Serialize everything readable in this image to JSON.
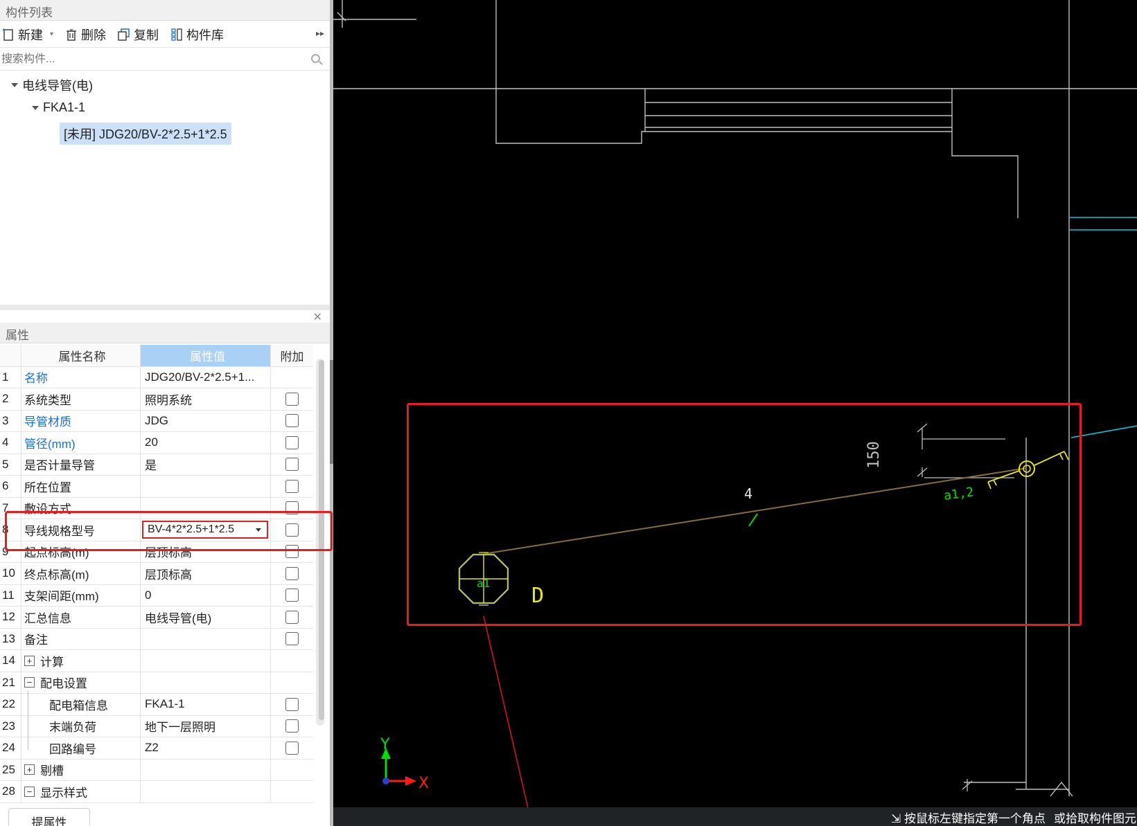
{
  "component_list": {
    "title": "构件列表",
    "toolbar": {
      "new": "新建",
      "delete": "删除",
      "copy": "复制",
      "library": "构件库"
    },
    "search_placeholder": "搜索构件...",
    "tree": {
      "root": "电线导管(电)",
      "child": "FKA1-1",
      "selected_item": "[未用] JDG20/BV-2*2.5+1*2.5"
    }
  },
  "properties": {
    "title": "属性",
    "columns": {
      "name": "属性名称",
      "value": "属性值",
      "extra": "附加"
    },
    "rows": [
      {
        "num": "1",
        "name": "名称",
        "value": "JDG20/BV-2*2.5+1...",
        "blue": true,
        "checkbox": false
      },
      {
        "num": "2",
        "name": "系统类型",
        "value": "照明系统",
        "blue": false,
        "checkbox": true
      },
      {
        "num": "3",
        "name": "导管材质",
        "value": "JDG",
        "blue": true,
        "checkbox": true
      },
      {
        "num": "4",
        "name": "管径(mm)",
        "value": "20",
        "blue": true,
        "checkbox": true
      },
      {
        "num": "5",
        "name": "是否计量导管",
        "value": "是",
        "blue": false,
        "checkbox": true
      },
      {
        "num": "6",
        "name": "所在位置",
        "value": "",
        "blue": false,
        "checkbox": true
      },
      {
        "num": "7",
        "name": "敷设方式",
        "value": "",
        "blue": false,
        "checkbox": true
      },
      {
        "num": "8",
        "name": "导线规格型号",
        "value": "BV-4*2*2.5+1*2.5",
        "blue": false,
        "checkbox": true,
        "dropdown": true
      },
      {
        "num": "9",
        "name": "起点标高(m)",
        "value": "层顶标高",
        "blue": false,
        "checkbox": true
      },
      {
        "num": "10",
        "name": "终点标高(m)",
        "value": "层顶标高",
        "blue": false,
        "checkbox": true
      },
      {
        "num": "11",
        "name": "支架间距(mm)",
        "value": "0",
        "blue": false,
        "checkbox": true
      },
      {
        "num": "12",
        "name": "汇总信息",
        "value": "电线导管(电)",
        "blue": false,
        "checkbox": true
      },
      {
        "num": "13",
        "name": "备注",
        "value": "",
        "blue": false,
        "checkbox": true
      },
      {
        "num": "14",
        "name": "计算",
        "value": "",
        "group": "+",
        "checkbox": false
      },
      {
        "num": "21",
        "name": "配电设置",
        "value": "",
        "group": "−",
        "checkbox": false
      },
      {
        "num": "22",
        "name": "配电箱信息",
        "value": "FKA1-1",
        "child": true,
        "checkbox": true
      },
      {
        "num": "23",
        "name": "末端负荷",
        "value": "地下一层照明",
        "child": true,
        "checkbox": true
      },
      {
        "num": "24",
        "name": "回路编号",
        "value": "Z2",
        "child": true,
        "checkbox": true
      },
      {
        "num": "25",
        "name": "剔槽",
        "value": "",
        "group": "+",
        "checkbox": false
      },
      {
        "num": "28",
        "name": "显示样式",
        "value": "",
        "group": "−",
        "checkbox": false
      }
    ],
    "bottom_tab": "提属性"
  },
  "cad": {
    "labels": {
      "segment_count": "4",
      "left_device": "a1",
      "right_circuit": "a1,2",
      "dimension": "150",
      "device_letter": "D",
      "axis_x": "X",
      "axis_y": "Y"
    },
    "status_1": "按鼠标左键指定第一个角点",
    "status_2": "或拾取构件图元"
  },
  "colors": {
    "highlight": "#e81c1c",
    "header_blue": "#a9d0f5",
    "link_blue": "#1a6fd8",
    "cad_yellow": "#e8e800",
    "cad_green": "#00e000",
    "cad_cyan": "#00c8e8"
  }
}
